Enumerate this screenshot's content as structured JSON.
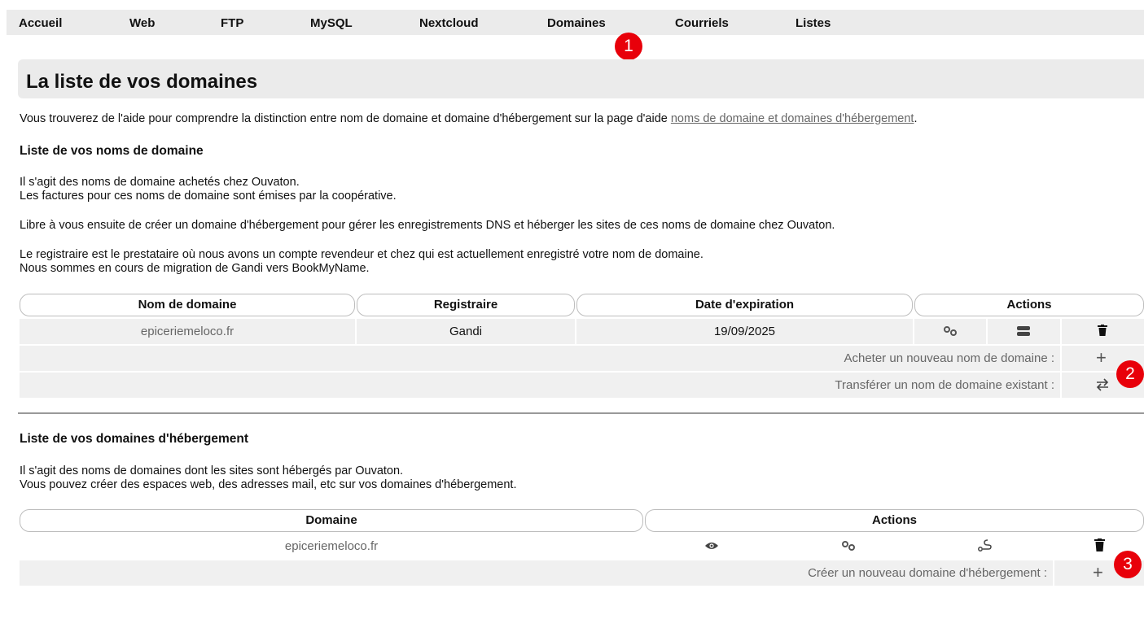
{
  "nav": {
    "items": [
      "Accueil",
      "Web",
      "FTP",
      "MySQL",
      "Nextcloud",
      "Domaines",
      "Courriels",
      "Listes"
    ]
  },
  "badges": [
    "1",
    "2",
    "3"
  ],
  "page": {
    "title": "La liste de vos domaines",
    "intro_text": "Vous trouverez de l'aide pour comprendre la distinction entre nom de domaine et domaine d'hébergement sur la page d'aide ",
    "intro_link": "noms de domaine et domaines d'hébergement",
    "intro_end": "."
  },
  "names_section": {
    "heading": "Liste de vos noms de domaine",
    "p1_line1": "Il s'agit des noms de domaine achetés chez Ouvaton.",
    "p1_line2": "Les factures pour ces noms de domaine sont émises par la coopérative.",
    "p2": "Libre à vous ensuite de créer un domaine d'hébergement pour gérer les enregistrements DNS et héberger les sites de ces noms de domaine chez Ouvaton.",
    "p3_line1": "Le registraire est le prestataire où nous avons un compte revendeur et chez qui est actuellement enregistré votre nom de domaine.",
    "p3_line2": "Nous sommes en cours de migration de Gandi vers BookMyName.",
    "columns": [
      "Nom de domaine",
      "Registraire",
      "Date d'expiration",
      "Actions"
    ],
    "rows": [
      {
        "domain": "epiceriemeloco.fr",
        "registrar": "Gandi",
        "expiry": "19/09/2025"
      }
    ],
    "buy_label": "Acheter un nouveau nom de domaine :",
    "transfer_label": "Transférer un nom de domaine existant :"
  },
  "hosting_section": {
    "heading": "Liste de vos domaines d'hébergement",
    "p1_line1": "Il s'agit des noms de domaines dont les sites sont hébergés par Ouvaton.",
    "p1_line2": "Vous pouvez créer des espaces web, des adresses mail, etc sur vos domaines d'hébergement.",
    "columns": [
      "Domaine",
      "Actions"
    ],
    "rows": [
      {
        "domain": "epiceriemeloco.fr"
      }
    ],
    "create_label": "Créer un nouveau domaine d'hébergement :"
  },
  "icons": {
    "settings": "gears-icon",
    "server": "server-icon",
    "delete": "trash-icon",
    "add": "plus-icon",
    "transfer": "transfer-arrows-icon",
    "view": "eye-icon",
    "route": "route-icon"
  },
  "colors": {
    "badge": "#e8000a",
    "nav_bg": "#ebebeb",
    "row_bg": "#f0f0f0",
    "link": "#666666"
  }
}
